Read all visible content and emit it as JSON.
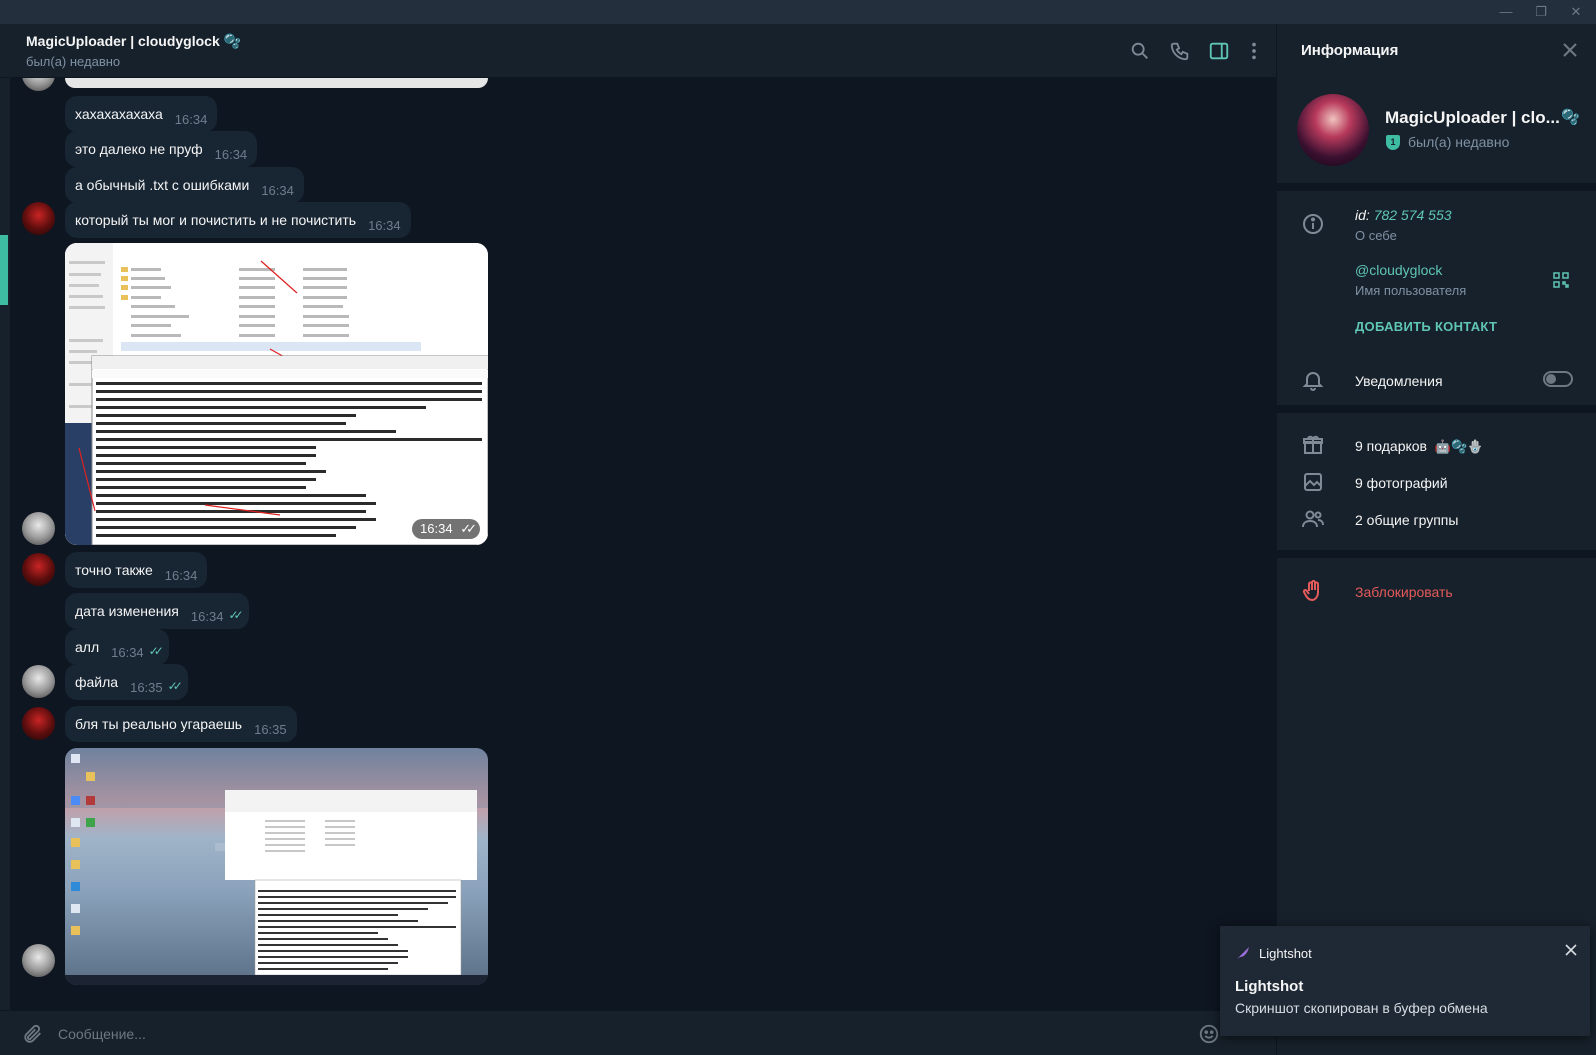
{
  "window": {
    "minimize": "—",
    "restore": "❐",
    "close": "✕"
  },
  "header": {
    "title": "MagicUploader | cloudyglock",
    "emoji": "🫧",
    "status": "был(а) недавно",
    "icons": [
      "search-icon",
      "phone-icon",
      "sidebar-toggle-icon",
      "more-vertical-icon"
    ]
  },
  "messages": [
    {
      "text": "хахахахахаха",
      "time": "16:34",
      "read": false
    },
    {
      "text": "это далеко не пруф",
      "time": "16:34",
      "read": false
    },
    {
      "text": "а обычный .txt с ошибками",
      "time": "16:34",
      "read": false
    },
    {
      "text": "который ты мог и почистить и не почистить",
      "time": "16:34",
      "read": false
    },
    {
      "type": "photo",
      "time": "16:34",
      "read": true
    },
    {
      "text": "точно также",
      "time": "16:34",
      "read": false
    },
    {
      "text": "дата изменения",
      "time": "16:34",
      "read": true
    },
    {
      "text": "алл",
      "time": "16:34",
      "read": true
    },
    {
      "text": "файла",
      "time": "16:35",
      "read": true
    },
    {
      "text": "бля ты реально угараешь",
      "time": "16:35",
      "read": false
    },
    {
      "type": "photo",
      "time": "",
      "read": false
    }
  ],
  "composer": {
    "placeholder": "Сообщение..."
  },
  "info": {
    "title": "Информация",
    "name": "MagicUploader | clo...",
    "status": "был(а) недавно",
    "verified_badge": "1",
    "id_prefix": "id:",
    "id_value": "782 574 553",
    "about_label": "О себе",
    "username": "@cloudyglock",
    "username_label": "Имя пользователя",
    "add_contact": "ДОБАВИТЬ КОНТАКТ",
    "notifications_label": "Уведомления",
    "notifications_on": false,
    "gifts": "9 подарков",
    "photos": "9 фотографий",
    "groups": "2 общие группы",
    "block": "Заблокировать"
  },
  "toast": {
    "app": "Lightshot",
    "title": "Lightshot",
    "body": "Скриншот скопирован в буфер обмена"
  },
  "colors": {
    "accent": "#5fc6b6",
    "bubble": "#182533",
    "background": "#0e1621",
    "panel": "#17212b",
    "danger": "#e45a5a"
  }
}
